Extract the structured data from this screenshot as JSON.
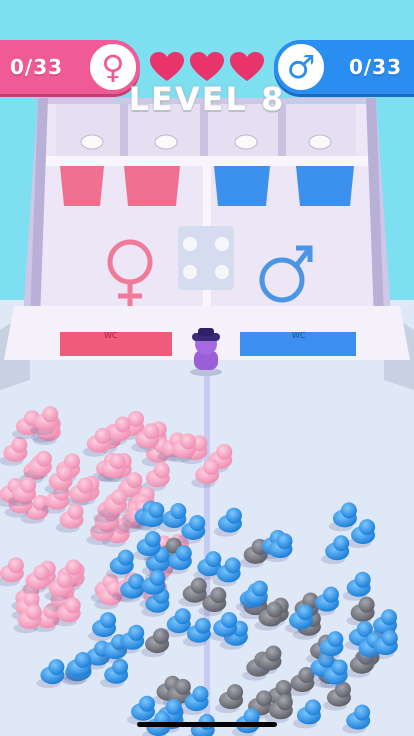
{
  "hud": {
    "female_count": "0/33",
    "male_count": "0/33",
    "female_symbol": "♀",
    "male_symbol": "♂",
    "hearts": 3,
    "level_text": "LEVEL 8"
  },
  "scene": {
    "female_door_label": "WC",
    "male_door_label": "WC",
    "female_room_symbol": "female-symbol-icon",
    "male_room_symbol": "male-symbol-icon"
  },
  "colors": {
    "sky": "#7ddff0",
    "floor": "#dfe8f7",
    "female": "#f05b97",
    "male": "#2a8ef0",
    "pink_crowd": "#f7a6c2",
    "blue_crowd": "#2f9be8",
    "gray_crowd": "#7f8088",
    "player": "#9a5fd6",
    "heart": "#e8336b"
  }
}
